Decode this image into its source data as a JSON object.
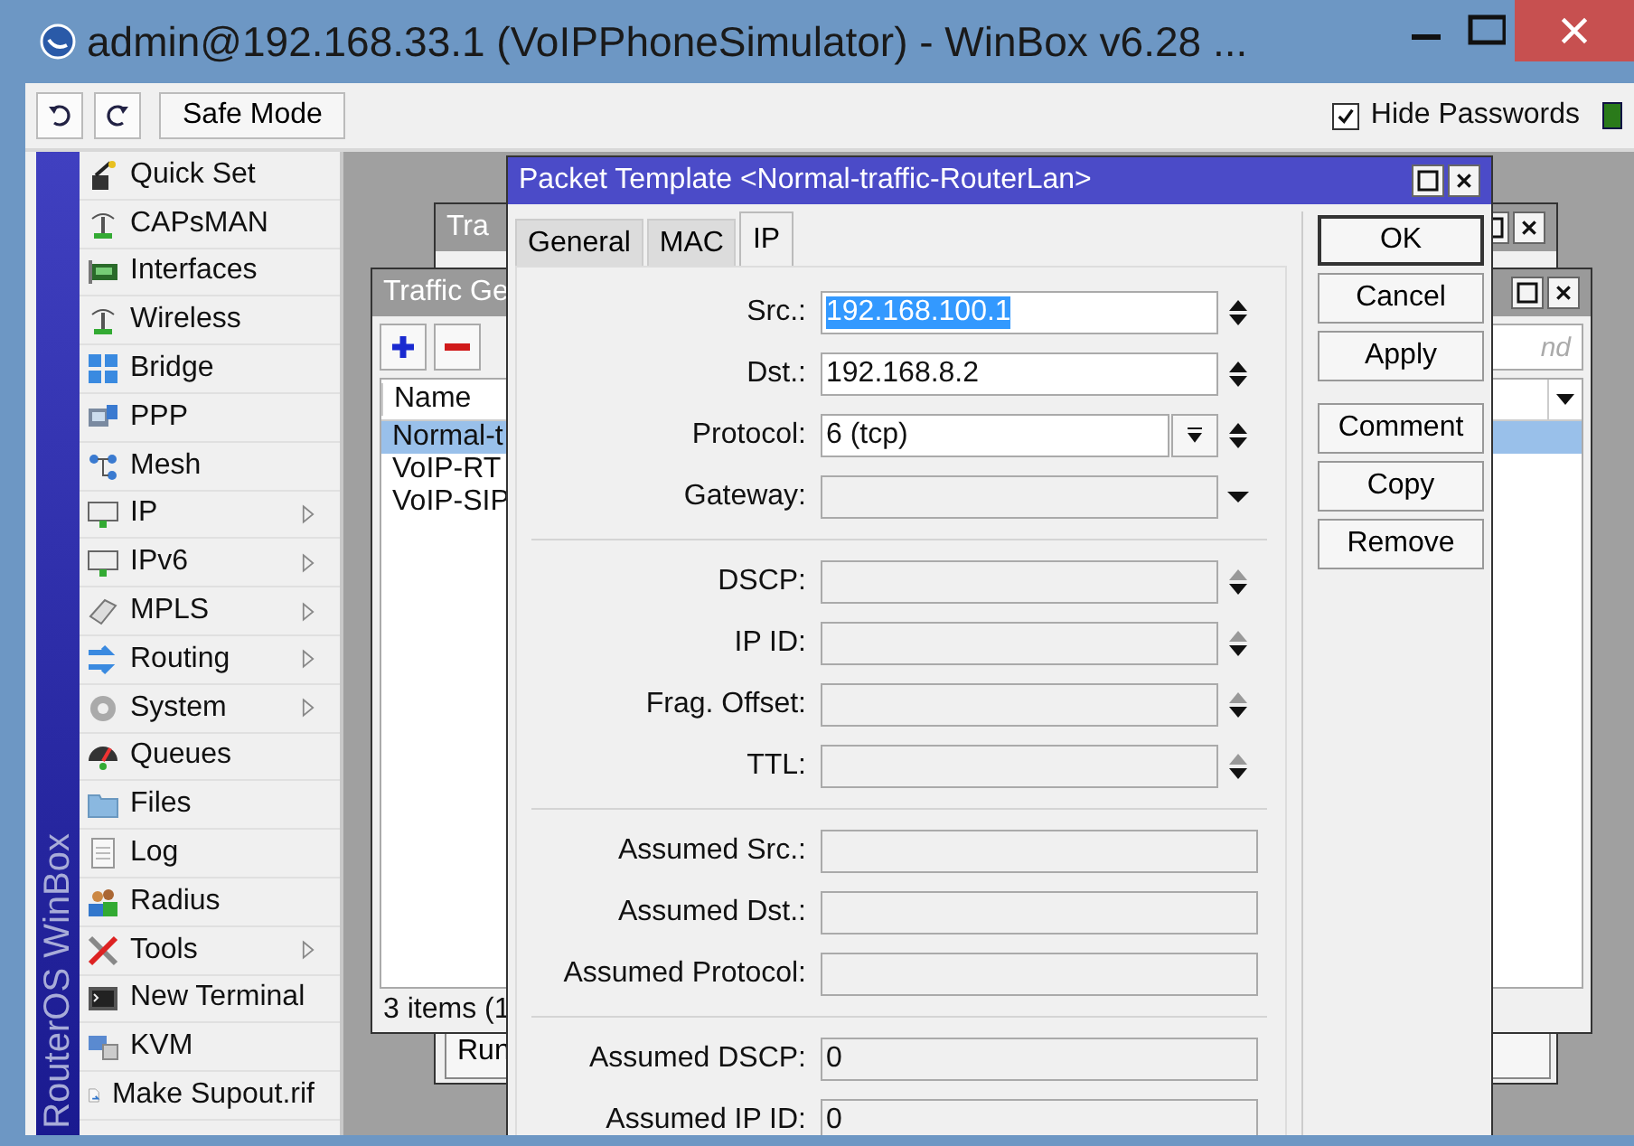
{
  "window": {
    "title": "admin@192.168.33.1 (VoIPPhoneSimulator) - WinBox v6.28 ..."
  },
  "toolbar": {
    "safe_mode": "Safe Mode",
    "hide_passwords": {
      "label": "Hide Passwords",
      "checked": true
    }
  },
  "sidebar": {
    "brand": "RouterOS WinBox",
    "items": [
      {
        "label": "Quick Set",
        "submenu": false
      },
      {
        "label": "CAPsMAN",
        "submenu": false
      },
      {
        "label": "Interfaces",
        "submenu": false
      },
      {
        "label": "Wireless",
        "submenu": false
      },
      {
        "label": "Bridge",
        "submenu": false
      },
      {
        "label": "PPP",
        "submenu": false
      },
      {
        "label": "Mesh",
        "submenu": false
      },
      {
        "label": "IP",
        "submenu": true
      },
      {
        "label": "IPv6",
        "submenu": true
      },
      {
        "label": "MPLS",
        "submenu": true
      },
      {
        "label": "Routing",
        "submenu": true
      },
      {
        "label": "System",
        "submenu": true
      },
      {
        "label": "Queues",
        "submenu": false
      },
      {
        "label": "Files",
        "submenu": false
      },
      {
        "label": "Log",
        "submenu": false
      },
      {
        "label": "Radius",
        "submenu": false
      },
      {
        "label": "Tools",
        "submenu": true
      },
      {
        "label": "New Terminal",
        "submenu": false
      },
      {
        "label": "KVM",
        "submenu": false
      },
      {
        "label": "Make Supout.rif",
        "submenu": false
      }
    ]
  },
  "back_window": {
    "title": "Tra",
    "run": "Run"
  },
  "traffic_window": {
    "title": "Traffic Ge",
    "columns": [
      "Name"
    ],
    "find_placeholder": "nd",
    "status": "3 items (1",
    "rows": [
      {
        "name": "Normal-t",
        "selected": true
      },
      {
        "name": "VoIP-RT",
        "selected": false
      },
      {
        "name": "VoIP-SIP",
        "selected": false
      }
    ]
  },
  "dialog": {
    "title": "Packet Template <Normal-traffic-RouterLan>",
    "tabs": [
      {
        "label": "General",
        "selected": false
      },
      {
        "label": "MAC",
        "selected": false
      },
      {
        "label": "IP",
        "selected": true
      }
    ],
    "sections": [
      {
        "fields": [
          {
            "label": "Src.:",
            "value": "192.168.100.1",
            "kind": "spin",
            "disabled": false,
            "highlighted": true
          },
          {
            "label": "Dst.:",
            "value": "192.168.8.2",
            "kind": "spin",
            "disabled": false,
            "highlighted": false
          },
          {
            "label": "Protocol:",
            "value": "6 (tcp)",
            "kind": "combo",
            "disabled": false,
            "highlighted": false
          },
          {
            "label": "Gateway:",
            "kind": "dropdown",
            "disabled": true
          }
        ]
      },
      {
        "fields": [
          {
            "label": "DSCP:",
            "kind": "spin",
            "disabled": true
          },
          {
            "label": "IP ID:",
            "kind": "spin",
            "disabled": true
          },
          {
            "label": "Frag. Offset:",
            "kind": "spin",
            "disabled": true
          },
          {
            "label": "TTL:",
            "kind": "spin",
            "disabled": true
          }
        ]
      },
      {
        "fields": [
          {
            "label": "Assumed Src.:",
            "kind": "text",
            "disabled": true
          },
          {
            "label": "Assumed Dst.:",
            "kind": "text",
            "disabled": true
          },
          {
            "label": "Assumed Protocol:",
            "kind": "text",
            "disabled": true
          }
        ]
      },
      {
        "fields": [
          {
            "label": "Assumed DSCP:",
            "value": "0",
            "kind": "text",
            "disabled": true,
            "highlighted": false
          },
          {
            "label": "Assumed IP ID:",
            "value": "0",
            "kind": "text",
            "disabled": true,
            "highlighted": false
          }
        ]
      }
    ],
    "buttons": [
      {
        "label": "OK",
        "default": true
      },
      {
        "label": "Cancel",
        "default": false
      },
      {
        "label": "Apply",
        "default": false
      },
      {
        "label": "Comment",
        "default": false
      },
      {
        "label": "Copy",
        "default": false
      },
      {
        "label": "Remove",
        "default": false
      }
    ]
  }
}
